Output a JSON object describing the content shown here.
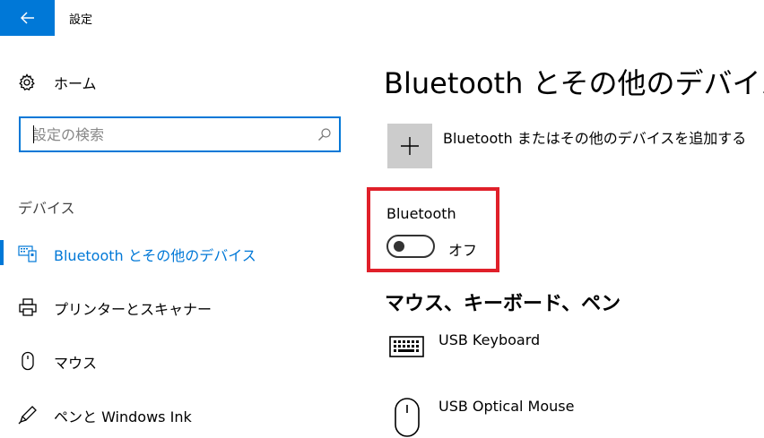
{
  "window": {
    "title": "設定"
  },
  "sidebar": {
    "home_label": "ホーム",
    "search": {
      "value": "",
      "placeholder": "設定の検索"
    },
    "section_label": "デバイス",
    "items": [
      {
        "label": "Bluetooth とその他のデバイス",
        "icon": "bluetooth-devices-icon",
        "selected": true
      },
      {
        "label": "プリンターとスキャナー",
        "icon": "printer-icon",
        "selected": false
      },
      {
        "label": "マウス",
        "icon": "mouse-icon",
        "selected": false
      },
      {
        "label": "ペンと Windows Ink",
        "icon": "pen-icon",
        "selected": false
      }
    ]
  },
  "main": {
    "title": "Bluetooth とその他のデバイス",
    "add_device_label": "Bluetooth またはその他のデバイスを追加する",
    "bluetooth": {
      "label": "Bluetooth",
      "state_label": "オフ",
      "enabled": false
    },
    "devices_heading": "マウス、キーボード、ペン",
    "devices": [
      {
        "name": "USB Keyboard",
        "icon": "keyboard-icon"
      },
      {
        "name": "USB Optical Mouse",
        "icon": "mouse-icon"
      }
    ]
  },
  "colors": {
    "accent": "#0078d7",
    "highlight_frame": "#e0202a",
    "tile_gray": "#cccccc"
  }
}
